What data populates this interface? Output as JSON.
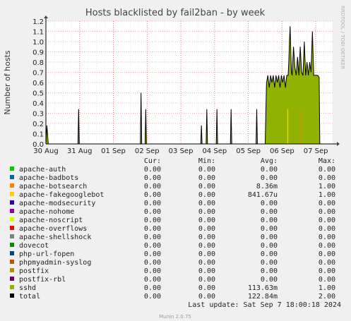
{
  "chart_data": {
    "type": "area",
    "title": "Hosts blacklisted by fail2ban - by week",
    "ylabel": "Number of hosts",
    "xlabel": "",
    "side_label": "RRDTOOL / TOBI OETIKER",
    "footer": "Munin 2.0.75",
    "ylim": [
      0,
      1.2
    ],
    "y_ticks": [
      "0.0",
      "0.1",
      "0.2",
      "0.3",
      "0.4",
      "0.5",
      "0.6",
      "0.7",
      "0.8",
      "0.9",
      "1.0",
      "1.1",
      "1.2"
    ],
    "x_ticks": [
      "30 Aug",
      "31 Aug",
      "01 Sep",
      "02 Sep",
      "03 Sep",
      "04 Sep",
      "05 Sep",
      "06 Sep",
      "07 Sep"
    ],
    "x_range_days": [
      0,
      8.5
    ],
    "grid": true,
    "columns": [
      "Cur:",
      "Min:",
      "Avg:",
      "Max:"
    ],
    "series": [
      {
        "name": "apache-auth",
        "color": "#00cc00",
        "cur": "0.00",
        "min": "0.00",
        "avg": "0.00",
        "max": "0.00"
      },
      {
        "name": "apache-badbots",
        "color": "#0066b3",
        "cur": "0.00",
        "min": "0.00",
        "avg": "0.00",
        "max": "0.00"
      },
      {
        "name": "apache-botsearch",
        "color": "#ff8000",
        "cur": "0.00",
        "min": "0.00",
        "avg": "8.36m",
        "max": "1.00"
      },
      {
        "name": "apache-fakegooglebot",
        "color": "#ffcc00",
        "cur": "0.00",
        "min": "0.00",
        "avg": "841.67u",
        "max": "1.00"
      },
      {
        "name": "apache-modsecurity",
        "color": "#330099",
        "cur": "0.00",
        "min": "0.00",
        "avg": "0.00",
        "max": "0.00"
      },
      {
        "name": "apache-nohome",
        "color": "#990099",
        "cur": "0.00",
        "min": "0.00",
        "avg": "0.00",
        "max": "0.00"
      },
      {
        "name": "apache-noscript",
        "color": "#ccff00",
        "cur": "0.00",
        "min": "0.00",
        "avg": "0.00",
        "max": "0.00"
      },
      {
        "name": "apache-overflows",
        "color": "#ff0000",
        "cur": "0.00",
        "min": "0.00",
        "avg": "0.00",
        "max": "0.00"
      },
      {
        "name": "apache-shellshock",
        "color": "#808080",
        "cur": "0.00",
        "min": "0.00",
        "avg": "0.00",
        "max": "0.00"
      },
      {
        "name": "dovecot",
        "color": "#008f00",
        "cur": "0.00",
        "min": "0.00",
        "avg": "0.00",
        "max": "0.00"
      },
      {
        "name": "php-url-fopen",
        "color": "#00487d",
        "cur": "0.00",
        "min": "0.00",
        "avg": "0.00",
        "max": "0.00"
      },
      {
        "name": "phpmyadmin-syslog",
        "color": "#b35a00",
        "cur": "0.00",
        "min": "0.00",
        "avg": "0.00",
        "max": "0.00"
      },
      {
        "name": "postfix",
        "color": "#b38f00",
        "cur": "0.00",
        "min": "0.00",
        "avg": "0.00",
        "max": "0.00"
      },
      {
        "name": "postfix-rbl",
        "color": "#6b006b",
        "cur": "0.00",
        "min": "0.00",
        "avg": "0.00",
        "max": "0.00"
      },
      {
        "name": "sshd",
        "color": "#8fb300",
        "cur": "0.00",
        "min": "0.00",
        "avg": "113.63m",
        "max": "1.00"
      },
      {
        "name": "total",
        "color": "#000000",
        "cur": "0.00",
        "min": "0.00",
        "avg": "122.84m",
        "max": "2.00"
      }
    ],
    "sshd_points": [
      [
        0.0,
        0
      ],
      [
        0.03,
        0.18
      ],
      [
        0.07,
        0
      ],
      [
        0.95,
        0
      ],
      [
        0.97,
        0.34
      ],
      [
        0.99,
        0
      ],
      [
        2.8,
        0
      ],
      [
        2.82,
        0.5
      ],
      [
        2.84,
        0
      ],
      [
        2.94,
        0
      ],
      [
        2.96,
        0.34
      ],
      [
        2.98,
        0
      ],
      [
        4.59,
        0
      ],
      [
        4.61,
        0.18
      ],
      [
        4.63,
        0
      ],
      [
        4.75,
        0
      ],
      [
        4.77,
        0.34
      ],
      [
        4.79,
        0
      ],
      [
        5.05,
        0
      ],
      [
        5.07,
        0.34
      ],
      [
        5.09,
        0
      ],
      [
        5.47,
        0
      ],
      [
        5.49,
        0.34
      ],
      [
        5.51,
        0
      ],
      [
        6.23,
        0
      ],
      [
        6.25,
        0.34
      ],
      [
        6.27,
        0
      ],
      [
        6.5,
        0
      ],
      [
        6.54,
        0.6
      ],
      [
        6.58,
        0.67
      ],
      [
        6.62,
        0.55
      ],
      [
        6.66,
        0.67
      ],
      [
        6.7,
        0.6
      ],
      [
        6.74,
        0.67
      ],
      [
        6.78,
        0.55
      ],
      [
        6.82,
        0.67
      ],
      [
        6.86,
        0.6
      ],
      [
        6.9,
        0.67
      ],
      [
        6.94,
        0.55
      ],
      [
        6.98,
        0.67
      ],
      [
        7.02,
        0.6
      ],
      [
        7.06,
        0.67
      ],
      [
        7.1,
        0.55
      ],
      [
        7.14,
        0.67
      ],
      [
        7.18,
        0.67
      ],
      [
        7.2,
        0.8
      ],
      [
        7.22,
        1.0
      ],
      [
        7.24,
        1.15
      ],
      [
        7.26,
        0.9
      ],
      [
        7.28,
        0.7
      ],
      [
        7.3,
        0.67
      ],
      [
        7.34,
        0.95
      ],
      [
        7.38,
        0.75
      ],
      [
        7.42,
        0.67
      ],
      [
        7.46,
        0.85
      ],
      [
        7.5,
        0.67
      ],
      [
        7.54,
        0.95
      ],
      [
        7.58,
        0.7
      ],
      [
        7.62,
        0.67
      ],
      [
        7.66,
        1.0
      ],
      [
        7.7,
        0.67
      ],
      [
        7.74,
        0.8
      ],
      [
        7.78,
        0.67
      ],
      [
        7.82,
        0.8
      ],
      [
        7.86,
        0.7
      ],
      [
        7.9,
        1.1
      ],
      [
        7.94,
        0.67
      ],
      [
        7.98,
        0.67
      ],
      [
        8.06,
        0.67
      ],
      [
        8.1,
        0.65
      ],
      [
        8.12,
        0
      ],
      [
        8.5,
        0
      ]
    ],
    "spikes": [
      {
        "series": "apache-botsearch",
        "x": 7.55,
        "y": 0.34
      },
      {
        "series": "apache-fakegooglebot",
        "x": 7.17,
        "y": 0.34
      }
    ],
    "last_update": "Last update:  Sat Sep  7 18:00:18 2024"
  }
}
